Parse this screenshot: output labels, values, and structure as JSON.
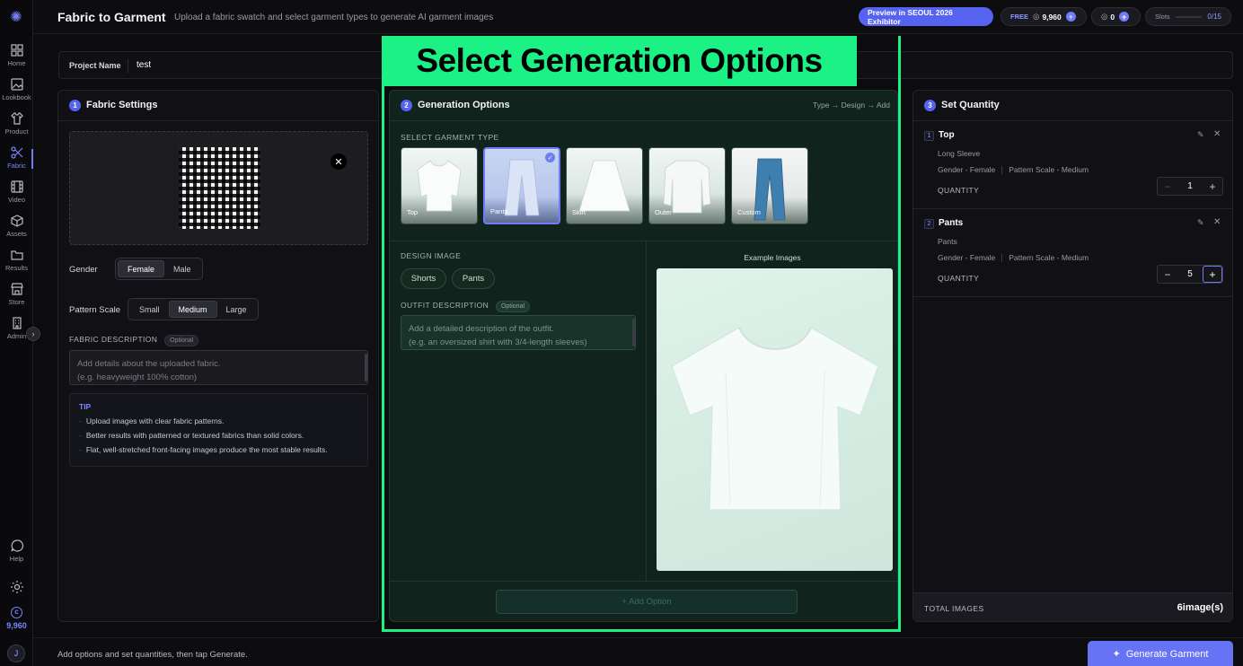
{
  "header": {
    "title": "Fabric to Garment",
    "subtitle": "Upload a fabric swatch and select garment types to generate AI garment images",
    "preview_button": "Preview in SEOUL 2026 Exhibitor",
    "plan_label": "FREE",
    "credits": "9,960",
    "coins": "0",
    "slots_label": "Slots",
    "slots_value": "0/15"
  },
  "sidebar": {
    "items": [
      {
        "label": "Home",
        "icon": "home-grid-icon"
      },
      {
        "label": "Lookbook",
        "icon": "image-icon"
      },
      {
        "label": "Product",
        "icon": "shirt-icon"
      },
      {
        "label": "Fabric",
        "icon": "scissors-icon"
      },
      {
        "label": "Video",
        "icon": "film-icon"
      },
      {
        "label": "Assets",
        "icon": "cube-icon"
      },
      {
        "label": "Results",
        "icon": "folder-icon"
      },
      {
        "label": "Store",
        "icon": "store-icon"
      },
      {
        "label": "Admin",
        "icon": "building-icon"
      }
    ],
    "help_label": "Help",
    "credits": "9,960",
    "user_initial": "J"
  },
  "project": {
    "label": "Project Name",
    "value": "test"
  },
  "banner": "Select Generation Options",
  "fabric_settings": {
    "step": "1",
    "title": "Fabric Settings",
    "gender_label": "Gender",
    "gender_options": [
      "Female",
      "Male"
    ],
    "pattern_label": "Pattern Scale",
    "pattern_options": [
      "Small",
      "Medium",
      "Large"
    ],
    "description_label": "FABRIC DESCRIPTION",
    "optional": "Optional",
    "description_placeholder_1": "Add details about the uploaded fabric.",
    "description_placeholder_2": "(e.g. heavyweight 100% cotton)",
    "tip_title": "TIP",
    "tips": [
      "Upload images with clear fabric patterns.",
      "Better results with patterned or textured fabrics than solid colors.",
      "Flat, well-stretched front-facing images produce the most stable results."
    ]
  },
  "generation": {
    "step": "2",
    "title": "Generation Options",
    "breadcrumb": "Type → Design → Add",
    "garment_type_label": "SELECT GARMENT TYPE",
    "garments": [
      "Top",
      "Pants",
      "Skirt",
      "Outer",
      "Custom"
    ],
    "selected_garment": "Pants",
    "design_image_label": "DESIGN IMAGE",
    "design_chips": [
      "Shorts",
      "Pants"
    ],
    "outfit_label": "OUTFIT DESCRIPTION",
    "optional": "Optional",
    "outfit_placeholder_1": "Add a detailed description of the outfit.",
    "outfit_placeholder_2": "(e.g. an oversized shirt with 3/4-length sleeves)",
    "example_label": "Example Images",
    "add_option": "+ Add Option"
  },
  "quantity": {
    "step": "3",
    "title": "Set Quantity",
    "items": [
      {
        "num": "1",
        "title": "Top",
        "sub": "Long Sleeve",
        "gender": "Gender - Female",
        "pattern": "Pattern Scale - Medium",
        "qty_label": "QUANTITY",
        "qty": "1"
      },
      {
        "num": "2",
        "title": "Pants",
        "sub": "Pants",
        "gender": "Gender - Female",
        "pattern": "Pattern Scale - Medium",
        "qty_label": "QUANTITY",
        "qty": "5"
      }
    ],
    "total_label": "TOTAL IMAGES",
    "total_value": "6image(s)"
  },
  "footer": {
    "hint": "Add options and set quantities, then tap Generate.",
    "generate_button": "Generate Garment"
  },
  "colors": {
    "accent": "#5663f0",
    "highlight": "#1cf185"
  }
}
